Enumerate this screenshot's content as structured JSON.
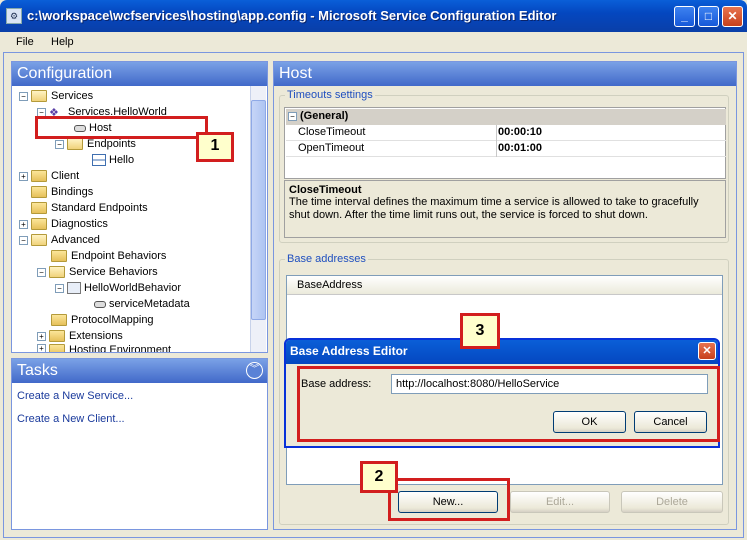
{
  "window": {
    "title": "c:\\workspace\\wcfservices\\hosting\\app.config - Microsoft Service Configuration Editor",
    "min": "_",
    "max": "□",
    "close": "✕"
  },
  "menu": {
    "file": "File",
    "help": "Help"
  },
  "config": {
    "header": "Configuration",
    "tree": {
      "services": "Services",
      "service_hw": "Services.HelloWorld",
      "host": "Host",
      "endpoints": "Endpoints",
      "hello": "Hello",
      "client": "Client",
      "bindings": "Bindings",
      "std_endpoints": "Standard Endpoints",
      "diagnostics": "Diagnostics",
      "advanced": "Advanced",
      "endpoint_behaviors": "Endpoint Behaviors",
      "service_behaviors": "Service Behaviors",
      "hw_behavior": "HelloWorldBehavior",
      "service_metadata": "serviceMetadata",
      "protocol_mapping": "ProtocolMapping",
      "extensions": "Extensions",
      "hosting_env": "Hosting Environment"
    }
  },
  "tasks": {
    "header": "Tasks",
    "new_service": "Create a New Service...",
    "new_client": "Create a New Client..."
  },
  "host": {
    "header": "Host",
    "timeouts_label": "Timeouts settings",
    "general": "(General)",
    "close_timeout_key": "CloseTimeout",
    "close_timeout_val": "00:00:10",
    "open_timeout_key": "OpenTimeout",
    "open_timeout_val": "00:01:00",
    "desc_title": "CloseTimeout",
    "desc_text": "The time interval defines the maximum time a service is allowed to take to gracefully shut down. After the time limit runs out, the service is forced to shut down.",
    "base_label": "Base addresses",
    "base_col": "BaseAddress",
    "new_btn": "New...",
    "edit_btn": "Edit...",
    "delete_btn": "Delete"
  },
  "dialog": {
    "title": "Base Address Editor",
    "label": "Base address:",
    "value": "http://localhost:8080/HelloService",
    "ok": "OK",
    "cancel": "Cancel"
  },
  "callouts": {
    "c1": "1",
    "c2": "2",
    "c3": "3"
  }
}
